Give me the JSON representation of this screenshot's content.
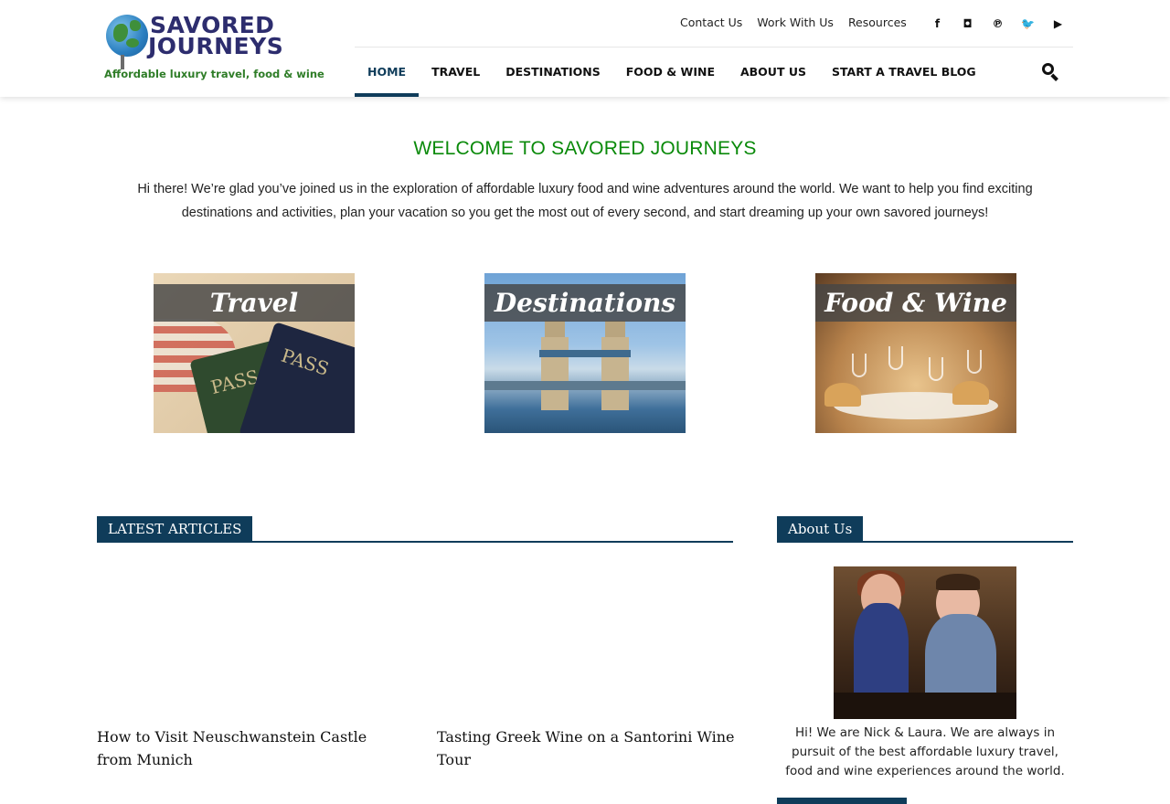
{
  "logo": {
    "line1": "SAVORED",
    "line2": "JOURNEYS",
    "tagline": "Affordable luxury travel, food & wine"
  },
  "top_links": [
    "Contact Us",
    "Work With Us",
    "Resources"
  ],
  "socials": [
    {
      "icon": "facebook-icon",
      "glyph": "f"
    },
    {
      "icon": "instagram-icon",
      "glyph": "◘"
    },
    {
      "icon": "pinterest-icon",
      "glyph": "℗"
    },
    {
      "icon": "twitter-icon",
      "glyph": "🐦"
    },
    {
      "icon": "youtube-icon",
      "glyph": "▶"
    }
  ],
  "nav": {
    "items": [
      "HOME",
      "TRAVEL",
      "DESTINATIONS",
      "FOOD & WINE",
      "ABOUT US",
      "START A TRAVEL BLOG"
    ],
    "active": "HOME"
  },
  "welcome": {
    "title": "WELCOME TO SAVORED JOURNEYS",
    "text": "Hi there! We’re glad you’ve joined us in the exploration of affordable luxury food and wine adventures around the world. We want to help you find exciting destinations and activities, plan your vacation so you get the most out of every second, and start dreaming up your own savored journeys!"
  },
  "tiles": {
    "travel": "Travel",
    "destinations": "Destinations",
    "food_wine": "Food & Wine",
    "passport_text": "PASS"
  },
  "latest": {
    "heading": "LATEST ARTICLES",
    "articles": [
      "How to Visit Neuschwanstein Castle from Munich",
      "Tasting Greek Wine on a Santorini Wine Tour"
    ]
  },
  "about": {
    "heading": "About Us",
    "text": "Hi! We are Nick & Laura. We are always in pursuit of the best affordable luxury travel, food and wine experiences around the world."
  },
  "colors": {
    "accent": "#0f3c5a",
    "welcome_title": "#0a8a0a",
    "logo_tagline": "#2f7d28"
  }
}
